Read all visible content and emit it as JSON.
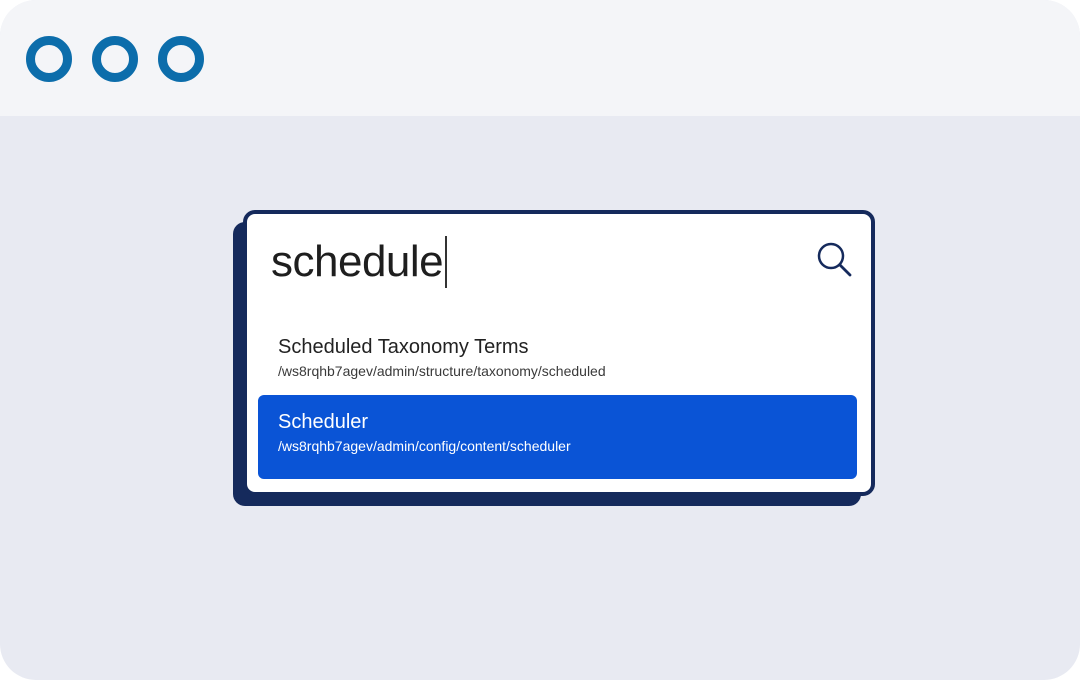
{
  "window": {
    "controls": [
      "window-dot",
      "window-dot",
      "window-dot"
    ],
    "accent_color": "#0c6dab"
  },
  "command_palette": {
    "search": {
      "value": "schedule",
      "icon": "search-icon"
    },
    "results": [
      {
        "title": "Scheduled Taxonomy Terms",
        "path": "/ws8rqhb7agev/admin/structure/taxonomy/scheduled",
        "selected": false
      },
      {
        "title": "Scheduler",
        "path": "/ws8rqhb7agev/admin/config/content/scheduler",
        "selected": true
      }
    ],
    "colors": {
      "border": "#152a5c",
      "selected_background": "#0a54d6"
    }
  }
}
